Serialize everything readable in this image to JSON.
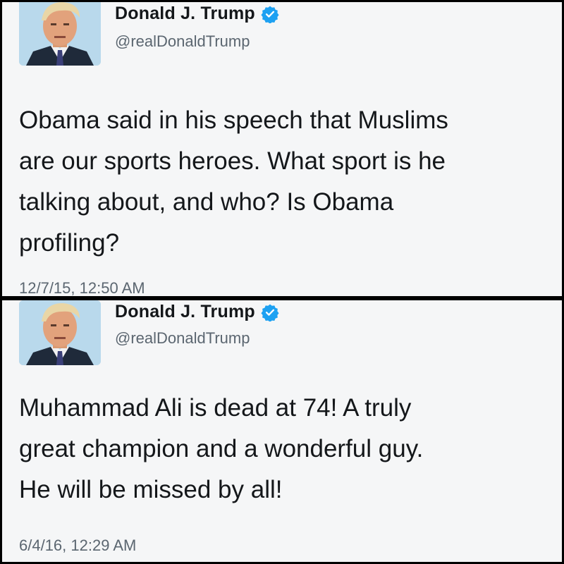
{
  "colors": {
    "verified_badge": "#1da1f2",
    "name_text": "#14171a",
    "secondary_text": "#5b6670",
    "card_background": "#f5f6f7",
    "border": "#000000"
  },
  "tweets": [
    {
      "author_name": "Donald J. Trump",
      "handle": "@realDonaldTrump",
      "verified_icon": "verified-badge-icon",
      "body_lines": [
        "Obama said in his speech that Muslims",
        "are our sports heroes. What sport is he",
        "talking about, and who? Is Obama",
        "profiling?"
      ],
      "timestamp": "12/7/15, 12:50 AM"
    },
    {
      "author_name": "Donald J. Trump",
      "handle": "@realDonaldTrump",
      "verified_icon": "verified-badge-icon",
      "body_lines": [
        "Muhammad Ali is dead at 74! A truly",
        "great champion and a wonderful guy.",
        "He will be missed by all!"
      ],
      "timestamp": "6/4/16, 12:29 AM"
    }
  ]
}
